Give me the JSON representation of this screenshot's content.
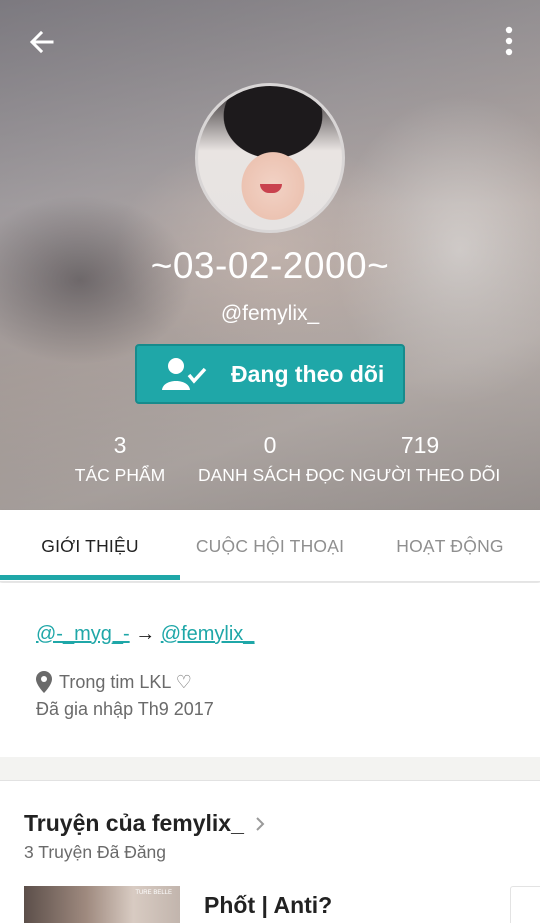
{
  "header": {
    "display_name": "~03-02-2000~",
    "username": "@femylix_",
    "follow_button_label": "Đang theo dõi"
  },
  "stats": [
    {
      "value": "3",
      "label": "TÁC PHẨM"
    },
    {
      "value": "0",
      "label": "DANH SÁCH ĐỌC"
    },
    {
      "value": "719",
      "label": "NGƯỜI THEO DÕI"
    }
  ],
  "tabs": [
    {
      "label": "GIỚI THIỆU",
      "active": true
    },
    {
      "label": "CUỘC HỘI THOẠI",
      "active": false
    },
    {
      "label": "HOẠT ĐỘNG",
      "active": false
    }
  ],
  "about": {
    "link_from": "@-_myg_-",
    "arrow": "→",
    "link_to": "@femylix_",
    "location": "Trong tim LKL ♡",
    "joined": "Đã gia nhập Th9 2017"
  },
  "stories": {
    "title": "Truyện của femylix_",
    "count_label": "3 Truyện Đã Đăng",
    "items": [
      {
        "title": "Phốt | Anti?",
        "cover_text": "TURE BELLE"
      }
    ]
  },
  "colors": {
    "accent": "#1fa7a8",
    "accent_border": "#168b8c",
    "muted_text": "#6a6a6a"
  },
  "icons": {
    "back": "arrow-left-icon",
    "more": "more-vertical-icon",
    "follow": "user-check-icon",
    "location": "location-pin-icon",
    "chevron": "chevron-right-icon"
  }
}
